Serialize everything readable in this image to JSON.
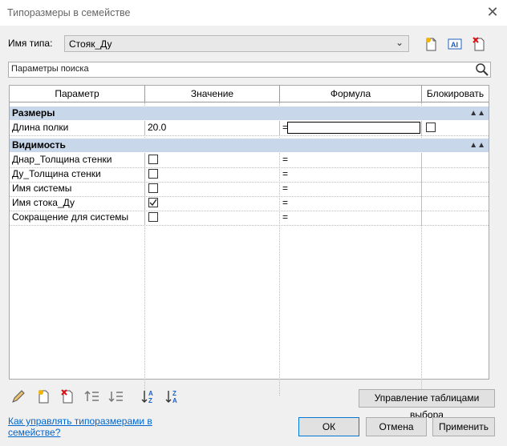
{
  "window": {
    "title": "Типоразмеры в семействе"
  },
  "type_row": {
    "label": "Имя типа:",
    "value": "Стояк_Ду",
    "tools": [
      {
        "icon": "new-type-icon",
        "tip": "Новый тип"
      },
      {
        "icon": "rename-type-icon",
        "tip": "Переименовать"
      },
      {
        "icon": "delete-type-icon",
        "tip": "Удалить тип"
      }
    ]
  },
  "search": {
    "placeholder": "Параметры поиска"
  },
  "table": {
    "headers": [
      "Параметр",
      "Значение",
      "Формула",
      "Блокировать"
    ],
    "groups": [
      {
        "name": "Размеры",
        "rows": [
          {
            "param": "Длина полки",
            "value": "20.0",
            "formula": "=",
            "lock": false
          }
        ]
      },
      {
        "name": "Видимость",
        "rows": [
          {
            "param": "Днар_Толщина стенки",
            "checked": false,
            "formula": "="
          },
          {
            "param": "Ду_Толщина стенки",
            "checked": false,
            "formula": "="
          },
          {
            "param": "Имя системы",
            "checked": false,
            "formula": "="
          },
          {
            "param": "Имя стока_Ду",
            "checked": true,
            "formula": "="
          },
          {
            "param": "Сокращение для системы",
            "checked": false,
            "formula": "="
          }
        ]
      }
    ]
  },
  "toolbar": {
    "icons": [
      "edit-icon",
      "new-param-icon",
      "delete-param-icon",
      "move-up-icon",
      "move-down-icon",
      "sort-asc-icon",
      "sort-desc-icon"
    ],
    "lookup_button": "Управление таблицами выбора"
  },
  "footer": {
    "help_link": "Как управлять типоразмерами в семействе?",
    "ok": "ОК",
    "cancel": "Отмена",
    "apply": "Применить"
  }
}
